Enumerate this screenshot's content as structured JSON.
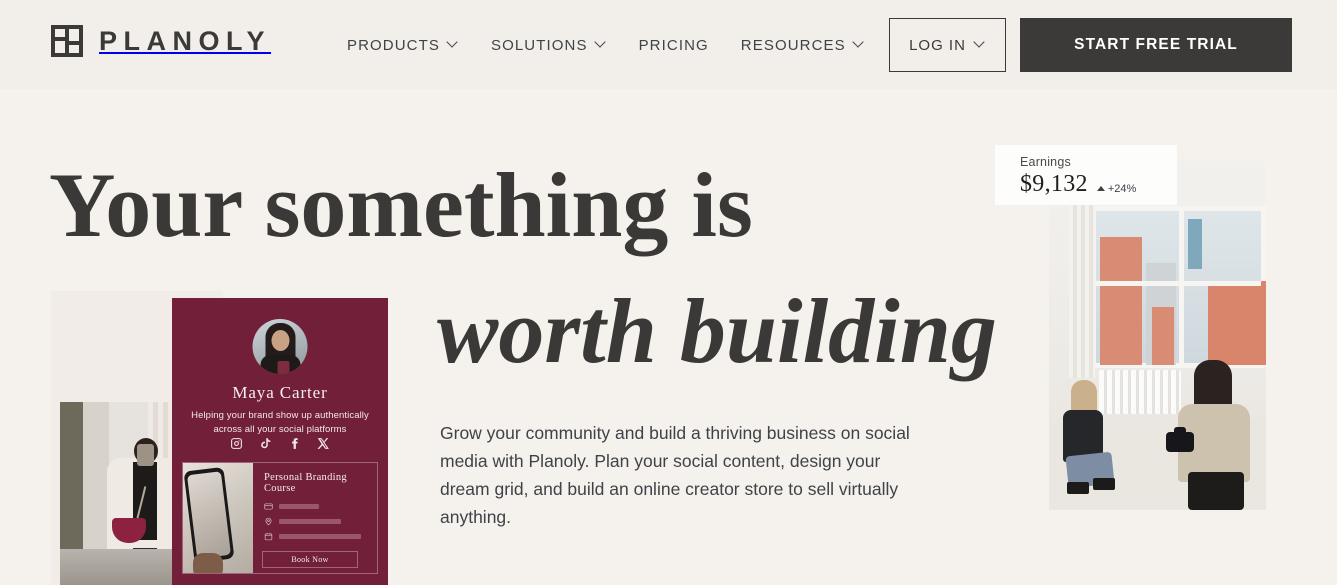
{
  "brand": {
    "name": "PLANOLY",
    "logo_icon": "planoly-grid-logo",
    "dark": "#3b3a38"
  },
  "header": {
    "nav": [
      {
        "label": "PRODUCTS",
        "has_dropdown": true
      },
      {
        "label": "SOLUTIONS",
        "has_dropdown": true
      },
      {
        "label": "PRICING",
        "has_dropdown": false
      },
      {
        "label": "RESOURCES",
        "has_dropdown": true
      }
    ],
    "login_label": "LOG IN",
    "trial_label": "START FREE TRIAL"
  },
  "hero": {
    "headline_line1": "Your something is",
    "headline_line2": "worth building",
    "body": "Grow your community and build a thriving business on social media with Planoly. Plan your social content, design your dream grid, and build an online creator store to sell virtually anything."
  },
  "earnings_card": {
    "label": "Earnings",
    "value": "$9,132",
    "delta": "+24%",
    "trend_icon": "triangle-up-icon"
  },
  "profile_card": {
    "name": "Maya Carter",
    "bio": "Helping your brand show up authentically across all your social platforms",
    "socials": [
      {
        "name": "instagram-icon"
      },
      {
        "name": "tiktok-icon"
      },
      {
        "name": "facebook-icon"
      },
      {
        "name": "x-icon"
      }
    ],
    "course": {
      "title": "Personal Branding Course",
      "rows": [
        {
          "icon": "credit-card-icon"
        },
        {
          "icon": "location-pin-icon"
        },
        {
          "icon": "calendar-icon"
        }
      ],
      "button_label": "Book Now"
    },
    "accent": "#72203a"
  },
  "media": {
    "left_photo_alt": "mirror selfie of woman in white blazer with burgundy bag",
    "right_photo_alt": "two women in a bright loft by large windows with camera"
  },
  "colors": {
    "page_background": "#f5f1ed",
    "header_background": "#f2eee9",
    "ink": "#3b3a38",
    "burgundy": "#72203a"
  }
}
